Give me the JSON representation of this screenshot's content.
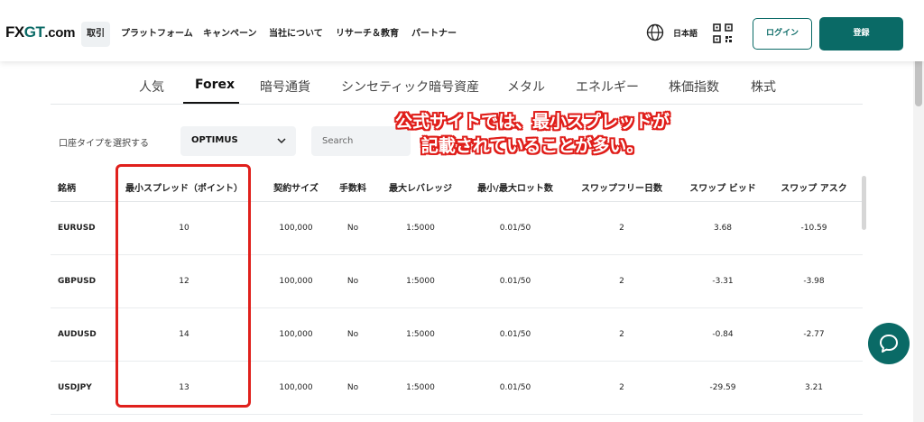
{
  "header": {
    "logo_main": "FX",
    "logo_g": "GT",
    "logo_domain": ".com",
    "nav": [
      "取引",
      "プラットフォーム",
      "キャンペーン",
      "当社について",
      "リサーチ＆教育",
      "パートナー"
    ],
    "language": "日本語",
    "login_label": "ログイン",
    "register_label": "登録"
  },
  "tabs": [
    "人気",
    "Forex",
    "暗号通貨",
    "シンセティック暗号資産",
    "メタル",
    "エネルギー",
    "株価指数",
    "株式"
  ],
  "active_tab": "Forex",
  "filters": {
    "account_type_label": "口座タイプを選択する",
    "account_type_value": "OPTIMUS",
    "search_placeholder": "Search"
  },
  "table": {
    "headers": [
      "銘柄",
      "最小スプレッド（ポイント）",
      "契約サイズ",
      "手数料",
      "最大レバレッジ",
      "最小/最大ロット数",
      "スワップフリー日数",
      "スワップ ビッド",
      "スワップ アスク"
    ],
    "rows": [
      [
        "EURUSD",
        "10",
        "100,000",
        "No",
        "1:5000",
        "0.01/50",
        "2",
        "3.68",
        "-10.59"
      ],
      [
        "GBPUSD",
        "12",
        "100,000",
        "No",
        "1:5000",
        "0.01/50",
        "2",
        "-3.31",
        "-3.98"
      ],
      [
        "AUDUSD",
        "14",
        "100,000",
        "No",
        "1:5000",
        "0.01/50",
        "2",
        "-0.84",
        "-2.77"
      ],
      [
        "USDJPY",
        "13",
        "100,000",
        "No",
        "1:5000",
        "0.01/50",
        "2",
        "-29.59",
        "3.21"
      ]
    ]
  },
  "annotation": {
    "line1": "公式サイトでは、最小スプレッドが",
    "line2": "記載されていることが多い。"
  },
  "colors": {
    "brand": "#0a6a66",
    "annotation_red": "#e0201c"
  },
  "icons": {
    "language": "globe-icon",
    "qr": "qr-code-icon",
    "dropdown": "chevron-down-icon",
    "chat": "chat-bubble-icon"
  }
}
